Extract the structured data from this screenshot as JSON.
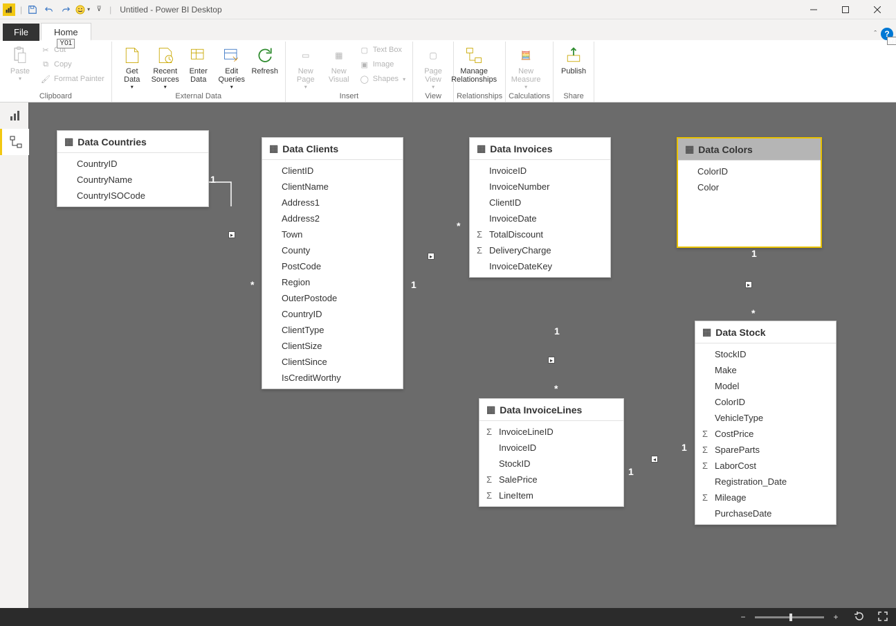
{
  "titlebar": {
    "title": "Untitled - Power BI Desktop"
  },
  "tabs": {
    "file": "File",
    "home": "Home",
    "homeKeytip": "Y01"
  },
  "ribbon": {
    "clipboard": {
      "label": "Clipboard",
      "paste": "Paste",
      "cut": "Cut",
      "copy": "Copy",
      "formatPainter": "Format Painter"
    },
    "externalData": {
      "label": "External Data",
      "getData": "Get\nData",
      "recentSources": "Recent\nSources",
      "enterData": "Enter\nData",
      "editQueries": "Edit\nQueries",
      "refresh": "Refresh"
    },
    "insert": {
      "label": "Insert",
      "newPage": "New\nPage",
      "newVisual": "New\nVisual",
      "textBox": "Text Box",
      "image": "Image",
      "shapes": "Shapes"
    },
    "view": {
      "label": "View",
      "pageView": "Page\nView"
    },
    "relationships": {
      "label": "Relationships",
      "manage": "Manage\nRelationships"
    },
    "calculations": {
      "label": "Calculations",
      "newMeasure": "New\nMeasure"
    },
    "share": {
      "label": "Share",
      "publish": "Publish"
    }
  },
  "tables": {
    "countries": {
      "title": "Data Countries",
      "fields": [
        {
          "name": "CountryID"
        },
        {
          "name": "CountryName"
        },
        {
          "name": "CountryISOCode"
        }
      ]
    },
    "clients": {
      "title": "Data Clients",
      "fields": [
        {
          "name": "ClientID"
        },
        {
          "name": "ClientName"
        },
        {
          "name": "Address1"
        },
        {
          "name": "Address2"
        },
        {
          "name": "Town"
        },
        {
          "name": "County"
        },
        {
          "name": "PostCode"
        },
        {
          "name": "Region"
        },
        {
          "name": "OuterPostode"
        },
        {
          "name": "CountryID"
        },
        {
          "name": "ClientType"
        },
        {
          "name": "ClientSize"
        },
        {
          "name": "ClientSince"
        },
        {
          "name": "IsCreditWorthy"
        }
      ]
    },
    "invoices": {
      "title": "Data Invoices",
      "fields": [
        {
          "name": "InvoiceID"
        },
        {
          "name": "InvoiceNumber"
        },
        {
          "name": "ClientID"
        },
        {
          "name": "InvoiceDate"
        },
        {
          "name": "TotalDiscount",
          "sigma": true
        },
        {
          "name": "DeliveryCharge",
          "sigma": true
        },
        {
          "name": "InvoiceDateKey"
        }
      ]
    },
    "colors": {
      "title": "Data Colors",
      "fields": [
        {
          "name": "ColorID"
        },
        {
          "name": "Color"
        }
      ]
    },
    "invoiceLines": {
      "title": "Data InvoiceLines",
      "fields": [
        {
          "name": "InvoiceLineID",
          "sigma": true
        },
        {
          "name": "InvoiceID"
        },
        {
          "name": "StockID"
        },
        {
          "name": "SalePrice",
          "sigma": true
        },
        {
          "name": "LineItem",
          "sigma": true
        }
      ]
    },
    "stock": {
      "title": "Data Stock",
      "fields": [
        {
          "name": "StockID"
        },
        {
          "name": "Make"
        },
        {
          "name": "Model"
        },
        {
          "name": "ColorID"
        },
        {
          "name": "VehicleType"
        },
        {
          "name": "CostPrice",
          "sigma": true
        },
        {
          "name": "SpareParts",
          "sigma": true
        },
        {
          "name": "LaborCost",
          "sigma": true
        },
        {
          "name": "Registration_Date"
        },
        {
          "name": "Mileage",
          "sigma": true
        },
        {
          "name": "PurchaseDate"
        }
      ]
    }
  },
  "cardinality": {
    "one": "1",
    "many": "*"
  }
}
